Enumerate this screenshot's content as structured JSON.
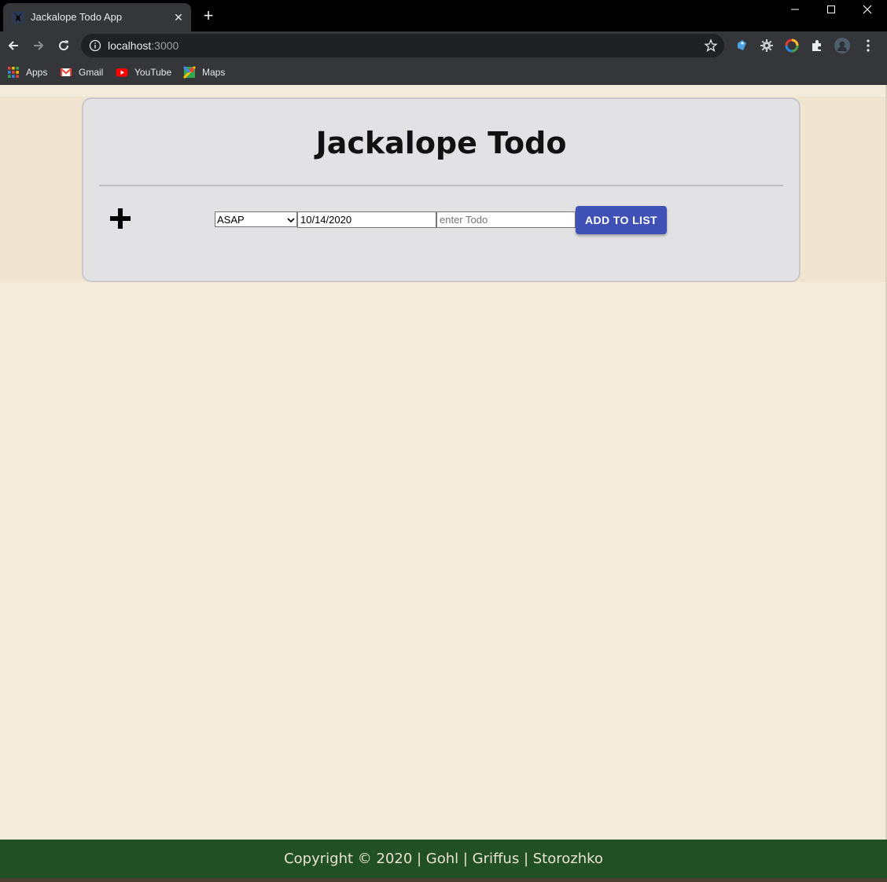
{
  "browser": {
    "tab_title": "Jackalope Todo App",
    "tab_close": "✕",
    "new_tab": "+",
    "url_host": "localhost",
    "url_port": ":3000",
    "bookmarks": [
      {
        "label": "Apps",
        "icon": "apps-grid-icon"
      },
      {
        "label": "Gmail",
        "icon": "gmail-icon"
      },
      {
        "label": "YouTube",
        "icon": "youtube-icon"
      },
      {
        "label": "Maps",
        "icon": "maps-icon"
      }
    ]
  },
  "app": {
    "title": "Jackalope Todo",
    "priority_selected": "ASAP",
    "date_value": "10/14/2020",
    "todo_placeholder": "enter Todo",
    "add_button_label": "ADD TO LIST",
    "accent_color": "#3f51b5"
  },
  "footer": {
    "text": "Copyright © 2020 | Gohl | Griffus | Storozhko",
    "color": "#215027"
  }
}
